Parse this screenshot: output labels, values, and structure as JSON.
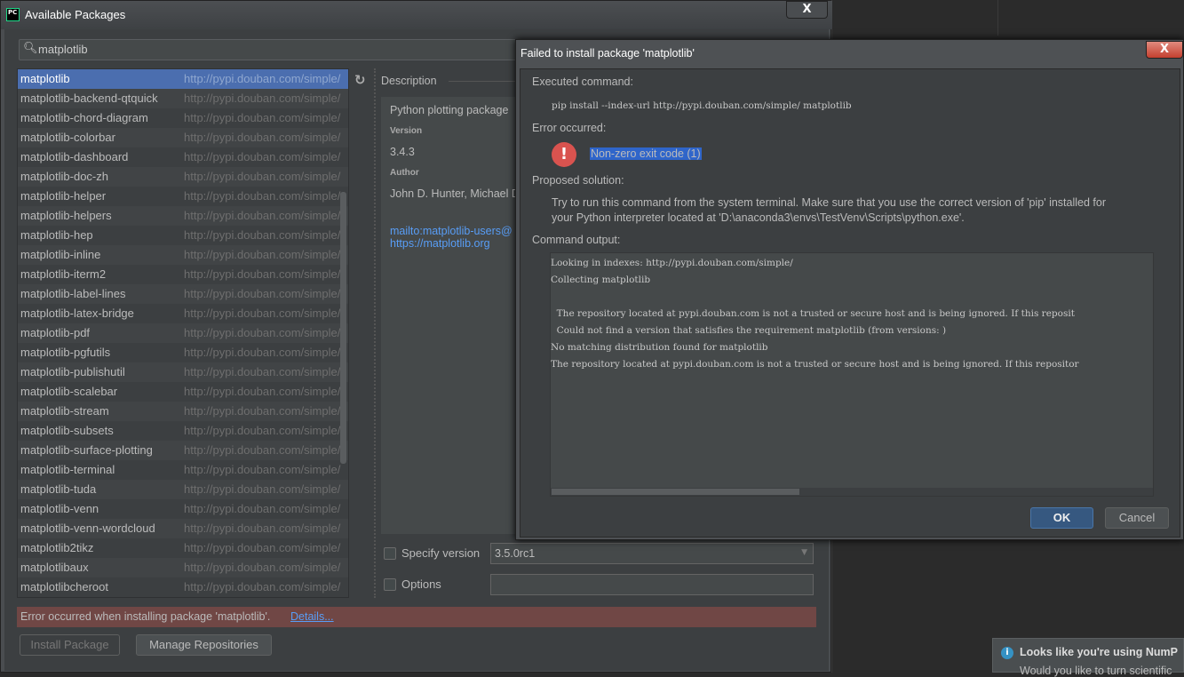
{
  "main_dialog": {
    "title": "Available Packages",
    "app_icon": "PC",
    "close": "X",
    "search": {
      "value": "matplotlib",
      "icon": "search-icon"
    },
    "packages": [
      {
        "name": "matplotlib",
        "repo": "http://pypi.douban.com/simple/",
        "selected": true
      },
      {
        "name": "matplotlib-backend-qtquick",
        "repo": "http://pypi.douban.com/simple/"
      },
      {
        "name": "matplotlib-chord-diagram",
        "repo": "http://pypi.douban.com/simple/"
      },
      {
        "name": "matplotlib-colorbar",
        "repo": "http://pypi.douban.com/simple/"
      },
      {
        "name": "matplotlib-dashboard",
        "repo": "http://pypi.douban.com/simple/"
      },
      {
        "name": "matplotlib-doc-zh",
        "repo": "http://pypi.douban.com/simple/"
      },
      {
        "name": "matplotlib-helper",
        "repo": "http://pypi.douban.com/simple/"
      },
      {
        "name": "matplotlib-helpers",
        "repo": "http://pypi.douban.com/simple/"
      },
      {
        "name": "matplotlib-hep",
        "repo": "http://pypi.douban.com/simple/"
      },
      {
        "name": "matplotlib-inline",
        "repo": "http://pypi.douban.com/simple/"
      },
      {
        "name": "matplotlib-iterm2",
        "repo": "http://pypi.douban.com/simple/"
      },
      {
        "name": "matplotlib-label-lines",
        "repo": "http://pypi.douban.com/simple/"
      },
      {
        "name": "matplotlib-latex-bridge",
        "repo": "http://pypi.douban.com/simple/"
      },
      {
        "name": "matplotlib-pdf",
        "repo": "http://pypi.douban.com/simple/"
      },
      {
        "name": "matplotlib-pgfutils",
        "repo": "http://pypi.douban.com/simple/"
      },
      {
        "name": "matplotlib-publishutil",
        "repo": "http://pypi.douban.com/simple/"
      },
      {
        "name": "matplotlib-scalebar",
        "repo": "http://pypi.douban.com/simple/"
      },
      {
        "name": "matplotlib-stream",
        "repo": "http://pypi.douban.com/simple/"
      },
      {
        "name": "matplotlib-subsets",
        "repo": "http://pypi.douban.com/simple/"
      },
      {
        "name": "matplotlib-surface-plotting",
        "repo": "http://pypi.douban.com/simple/"
      },
      {
        "name": "matplotlib-terminal",
        "repo": "http://pypi.douban.com/simple/"
      },
      {
        "name": "matplotlib-tuda",
        "repo": "http://pypi.douban.com/simple/"
      },
      {
        "name": "matplotlib-venn",
        "repo": "http://pypi.douban.com/simple/"
      },
      {
        "name": "matplotlib-venn-wordcloud",
        "repo": "http://pypi.douban.com/simple/"
      },
      {
        "name": "matplotlib2tikz",
        "repo": "http://pypi.douban.com/simple/"
      },
      {
        "name": "matplotlibaux",
        "repo": "http://pypi.douban.com/simple/"
      },
      {
        "name": "matplotlibcheroot",
        "repo": "http://pypi.douban.com/simple/"
      }
    ],
    "description": {
      "label": "Description",
      "summary": "Python plotting package",
      "version_label": "Version",
      "version": "3.4.3",
      "author_label": "Author",
      "author": "John D. Hunter, Michael D",
      "link1": "mailto:matplotlib-users@",
      "link2": "https://matplotlib.org"
    },
    "specify_version": {
      "label": "Specify version",
      "value": "3.5.0rc1",
      "checked": false
    },
    "options": {
      "label": "Options",
      "value": "",
      "checked": false
    },
    "error_bar": {
      "text": "Error occurred when installing package 'matplotlib'. ",
      "link": "Details...",
      "color": "#704745"
    },
    "install_button": "Install Package",
    "manage_button": "Manage Repositories"
  },
  "fail_dialog": {
    "title": "Failed to install package 'matplotlib'",
    "close": "X",
    "executed_label": "Executed command:",
    "command": "pip install --index-url http://pypi.douban.com/simple/ matplotlib",
    "error_label": "Error occurred:",
    "error": "Non-zero exit code (1)",
    "solution_label": "Proposed solution:",
    "solution_line1": "Try to run this command from the system terminal. Make sure that you use the correct version of 'pip' installed for",
    "solution_line2": "your Python interpreter located at 'D:\\anaconda3\\envs\\TestVenv\\Scripts\\python.exe'.",
    "output_label": "Command output:",
    "output": [
      "Looking in indexes: http://pypi.douban.com/simple/",
      "Collecting matplotlib",
      "",
      "  The repository located at pypi.douban.com is not a trusted or secure host and is being ignored. If this reposit",
      "  Could not find a version that satisfies the requirement matplotlib (from versions: )",
      "No matching distribution found for matplotlib",
      "The repository located at pypi.douban.com is not a trusted or secure host and is being ignored. If this repositor"
    ],
    "ok": "OK",
    "cancel": "Cancel"
  },
  "notification": {
    "title": "Looks like you're using NumP",
    "body": "Would you like to turn scientific"
  }
}
